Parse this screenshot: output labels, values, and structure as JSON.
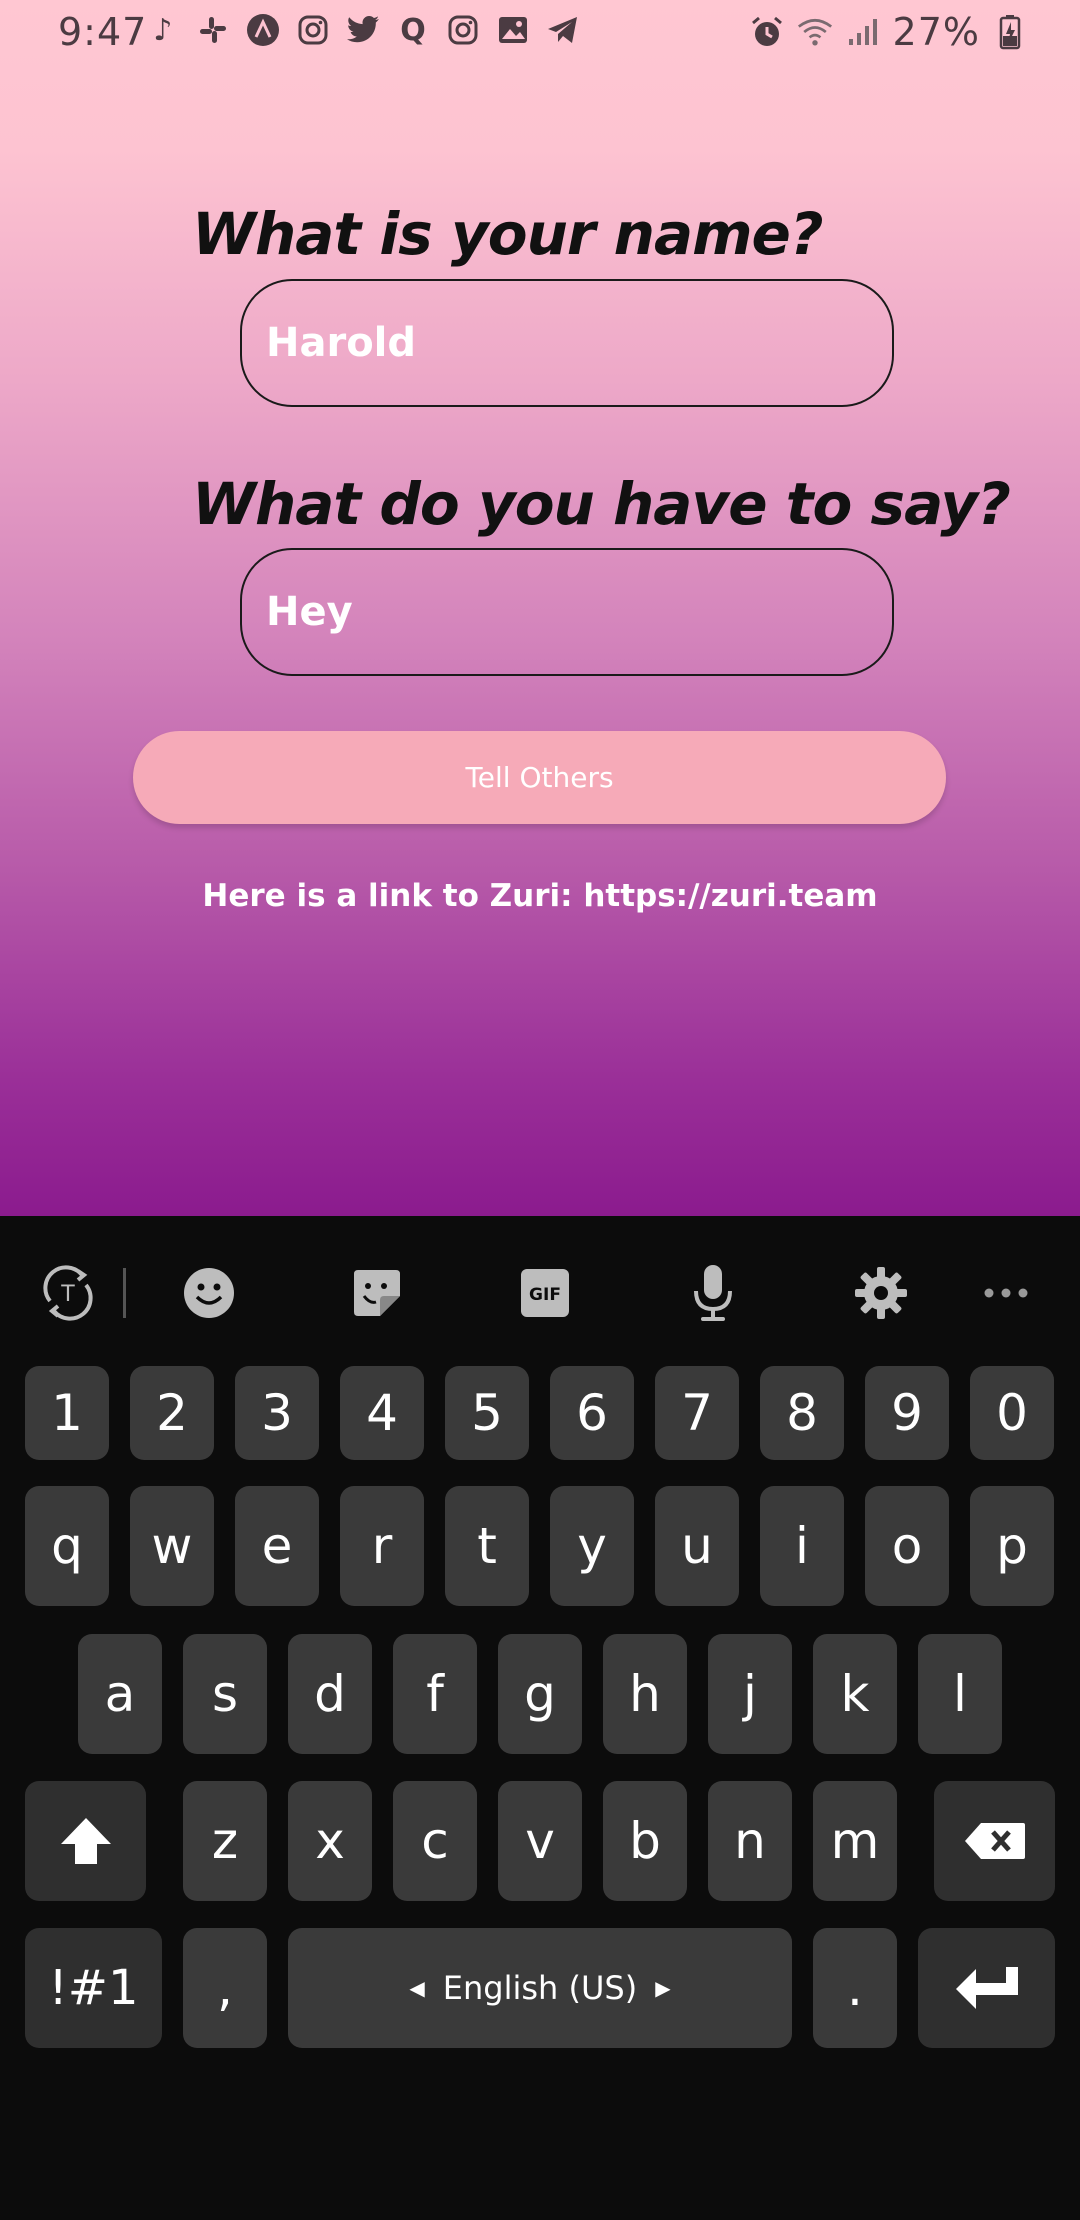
{
  "status_bar": {
    "time": "9:47",
    "left_icons": [
      "music-note-icon",
      "slack-icon",
      "arc-icon",
      "instagram-icon",
      "twitter-icon",
      "quora-icon",
      "instagram-icon",
      "image-icon",
      "telegram-icon"
    ],
    "battery_percent": "27%"
  },
  "form": {
    "name_label": "What is your name?",
    "name_value": "Harold",
    "message_label": "What do you have to say?",
    "message_value": "Hey",
    "submit_label": "Tell Others",
    "link_text": "Here is a link to Zuri: https://zuri.team"
  },
  "keyboard": {
    "row_numbers": [
      "1",
      "2",
      "3",
      "4",
      "5",
      "6",
      "7",
      "8",
      "9",
      "0"
    ],
    "row_1": [
      "q",
      "w",
      "e",
      "r",
      "t",
      "y",
      "u",
      "i",
      "o",
      "p"
    ],
    "row_2": [
      "a",
      "s",
      "d",
      "f",
      "g",
      "h",
      "j",
      "k",
      "l"
    ],
    "row_3": [
      "z",
      "x",
      "c",
      "v",
      "b",
      "n",
      "m"
    ],
    "symbols_label": "!#1",
    "comma": ",",
    "space_label": "English (US)",
    "period": ".",
    "gif_label": "GIF"
  },
  "colors": {
    "button_bg": "#f6aab8",
    "key_bg": "#3a3a3a",
    "keyboard_bg": "#0c0c0c"
  }
}
